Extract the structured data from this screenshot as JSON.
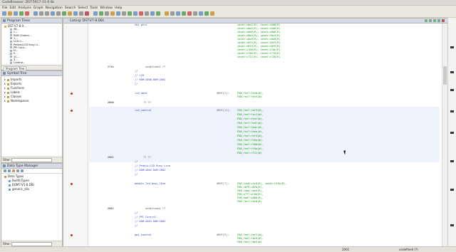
{
  "window": {
    "title": "CodeBrowser: DST-5917-31-0.lib"
  },
  "menu": [
    "File",
    "Edit",
    "Analysis",
    "Graph",
    "Navigation",
    "Search",
    "Select",
    "Tools",
    "Window",
    "Help"
  ],
  "program_tree": {
    "title": "Program Trees",
    "root": "DST-V7-8.0...",
    "items": [
      "98...",
      "C...",
      "RAM (Extern...",
      "1...",
      "LCD.d...",
      "Pedals/LCD Busy Li...",
      "PPI Cont...",
      "D...",
      "0...",
      "1C...",
      "3...",
      "Control..."
    ],
    "tab": "Program Tree"
  },
  "symbol_tree": {
    "title": "Symbol Tree",
    "items": [
      "Imports",
      "Exports",
      "Functions",
      "Labels",
      "Classes",
      "Namespaces"
    ],
    "filter_label": "Filter:"
  },
  "data_type_manager": {
    "title": "Data Type Manager",
    "items": [
      "Data Types",
      "BuiltInTypes",
      "ROM7-V1-8.DB)",
      "generic_clib"
    ],
    "filter_label": "Filter:"
  },
  "listing": {
    "tab_label": "Listing: DST-V7-8.DB)",
    "lines": [
      {
        "col": "lbl",
        "text": "tbl_ptrs"
      },
      {
        "col": "ref",
        "text": "zexet:c8a2(R), zexet:c8d0(R), zexet:c8a4(R), zexet:c8a6(R), zexet:c8a6(R), zexet:c8b0(R), zexet:c8b4(R), zexet:c8c4(R), zexet:c8e6(R), zexet:c8e8(R), zexet:c8f2(R), zexet:c8f5(R), zexet:c8f4(R), zexet:c8f6(R), zexet:c708(R), zexet:c7dc(R), zexet:c708(R), zexet:c718(R), zexet:c722(R), zexet:c728(R)"
      },
      {
        "col": "addr",
        "text": "27fe"
      },
      {
        "col": "ins",
        "text": "undefined2  ??"
      },
      {
        "col": "cmt",
        "text": "//"
      },
      {
        "col": "cmt",
        "text": "// LCD"
      },
      {
        "col": "cmt",
        "text": "// RAM:2000-RAM:2001"
      },
      {
        "col": "cmt",
        "text": "//"
      },
      {
        "col": "lbl",
        "text": "lcd_data"
      },
      {
        "col": "ins",
        "text": "XREF[2]:"
      },
      {
        "col": "ref",
        "text": "FUN_fec7:fe4b(W), FUN_fec7:fef6(W)"
      },
      {
        "col": "addr",
        "text": "2000"
      },
      {
        "col": "ins",
        "text": "??  ??"
      },
      {
        "col": "lbl",
        "text": "lcd_control"
      },
      {
        "col": "ins",
        "text": "XREF[11]:"
      },
      {
        "col": "ref",
        "text": "FUN_fee7:fef9(W), FUN_fee7:fec1(W), FUN_fee7:fed1(W), FUN_fec7:fed7(W), FUN_fec7:fedc(W), FUN_fec7:feee(W), FUN_fee7:fef3(W), FUN_fee7:ff0a(W), FUN_fee7:ff00(W), FUN_fee7:ff0a(W), FUN_fee7:ff12(W)"
      },
      {
        "col": "addr",
        "text": "2001"
      },
      {
        "col": "ins",
        "text": "??  ??"
      },
      {
        "col": "cmt",
        "text": "//"
      },
      {
        "col": "cmt",
        "text": "// Pedals/LCD Busy Line"
      },
      {
        "col": "cmt",
        "text": "// RAM:2002-RAM:2002"
      },
      {
        "col": "cmt",
        "text": "//"
      },
      {
        "col": "lbl",
        "text": "pedals_lcd_busy_line"
      },
      {
        "col": "ins",
        "text": "XREF[7]:"
      },
      {
        "col": "ref",
        "text": "FUN_c4c8:c4c8(R), zexet:c5fb(R), FUN_c879:c87b(R), FUN_caea:caea(R), FUN_e7f7:e7d0(R), FUN_ed67:ed6b(R), FUN_fec7:fec8(R)"
      },
      {
        "col": "addr",
        "text": "2002"
      },
      {
        "col": "ins",
        "text": "undefined1  ??"
      },
      {
        "col": "cmt",
        "text": "//"
      },
      {
        "col": "cmt",
        "text": "// PPI Control"
      },
      {
        "col": "cmt",
        "text": "// RAM:2003-RAM:2003"
      },
      {
        "col": "cmt",
        "text": "//"
      },
      {
        "col": "lbl",
        "text": "ppi_control"
      },
      {
        "col": "ins",
        "text": "XREF[5]:"
      },
      {
        "col": "ref",
        "text": "FUN_fee7:fef2(W), FUN_fee7:fbc9(W), FUN_fee7:fbe5(W)"
      }
    ]
  },
  "status": {
    "address": "2001",
    "type": "undefined (?)"
  }
}
